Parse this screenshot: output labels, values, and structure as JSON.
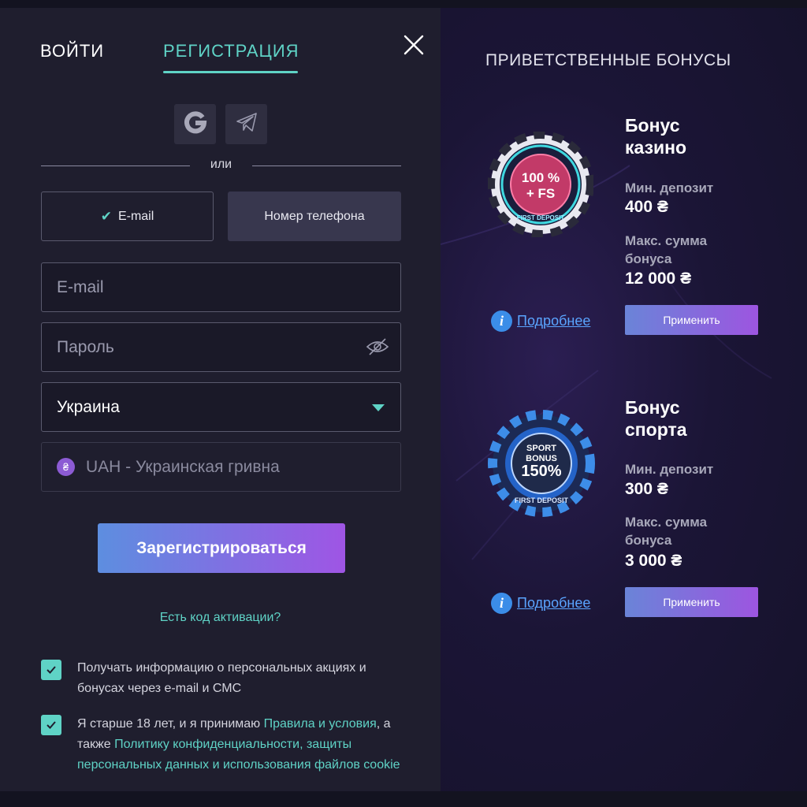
{
  "tabs": {
    "login": "ВОЙТИ",
    "register": "РЕГИСТРАЦИЯ"
  },
  "social": {
    "google_icon": "google-icon",
    "telegram_icon": "telegram-icon"
  },
  "divider": "или",
  "method": {
    "email": "E-mail",
    "phone": "Номер телефона",
    "selected": "email"
  },
  "form": {
    "email_placeholder": "E-mail",
    "password_placeholder": "Пароль",
    "country": "Украина",
    "currency": "UAH - Украинская гривна",
    "currency_symbol": "₴"
  },
  "register_button": "Зарегистрироваться",
  "activation_link": "Есть код активации?",
  "consents": {
    "promo": "Получать информацию о персональных акциях и бонусах через e-mail и СМС",
    "terms_prefix": "Я старше 18 лет, и я принимаю ",
    "terms_link": "Правила и условия",
    "terms_middle": ", а также ",
    "privacy_link": "Политику конфиденциальности, защиты персональных данных и использования файлов cookie"
  },
  "bonuses": {
    "title": "ПРИВЕТСТВЕННЫЕ БОНУСЫ",
    "casino": {
      "title_line1": "Бонус",
      "title_line2": "казино",
      "chip_line1": "100 %",
      "chip_line2": "+ FS",
      "chip_ring": "FIRST DEPOSIT",
      "min_label": "Мин. депозит",
      "min_value": "400 ₴",
      "max_label_line1": "Макс. сумма",
      "max_label_line2": "бонуса",
      "max_value": "12 000 ₴",
      "details": "Подробнее",
      "apply": "Применить"
    },
    "sport": {
      "title_line1": "Бонус",
      "title_line2": "спорта",
      "chip_line1": "SPORT",
      "chip_line2": "BONUS",
      "chip_line3": "150%",
      "chip_ring": "FIRST DEPOSIT",
      "min_label": "Мин. депозит",
      "min_value": "300 ₴",
      "max_label_line1": "Макс. сумма",
      "max_label_line2": "бонуса",
      "max_value": "3 000 ₴",
      "details": "Подробнее",
      "apply": "Применить"
    }
  },
  "colors": {
    "accent": "#5fd3c6",
    "panel": "#1f1e2e",
    "link_blue": "#5aa4ff"
  }
}
